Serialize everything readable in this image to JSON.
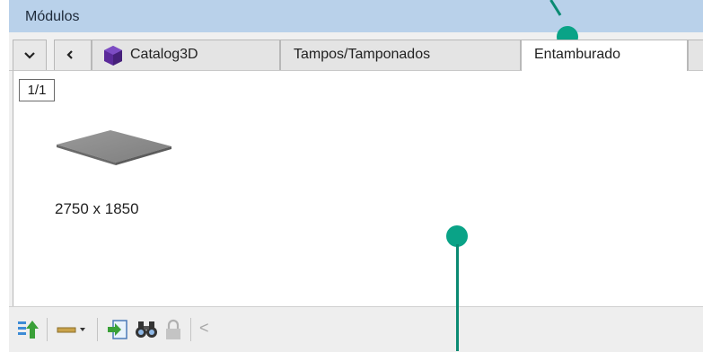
{
  "panel": {
    "title": "Módulos"
  },
  "tabs": [
    {
      "label": "Catalog3D",
      "icon": "purple-cube-icon"
    },
    {
      "label": "Tampos/Tamponados"
    },
    {
      "label": "Entamburado",
      "active": true
    }
  ],
  "content": {
    "page_indicator": "1/1",
    "items": [
      {
        "label": "2750 x 1850",
        "icon": "gray-slab-thumbnail"
      }
    ]
  },
  "toolbar": {
    "icons": [
      "sort-up-icon",
      "line-style-dropdown-icon",
      "import-icon",
      "binoculars-icon",
      "lock-icon",
      "scroll-left-icon"
    ],
    "scroll_left_glyph": "<"
  },
  "colors": {
    "titlebar": "#b9d1ea",
    "annotation": "#0aa387",
    "cube": "#5b2a9a"
  }
}
